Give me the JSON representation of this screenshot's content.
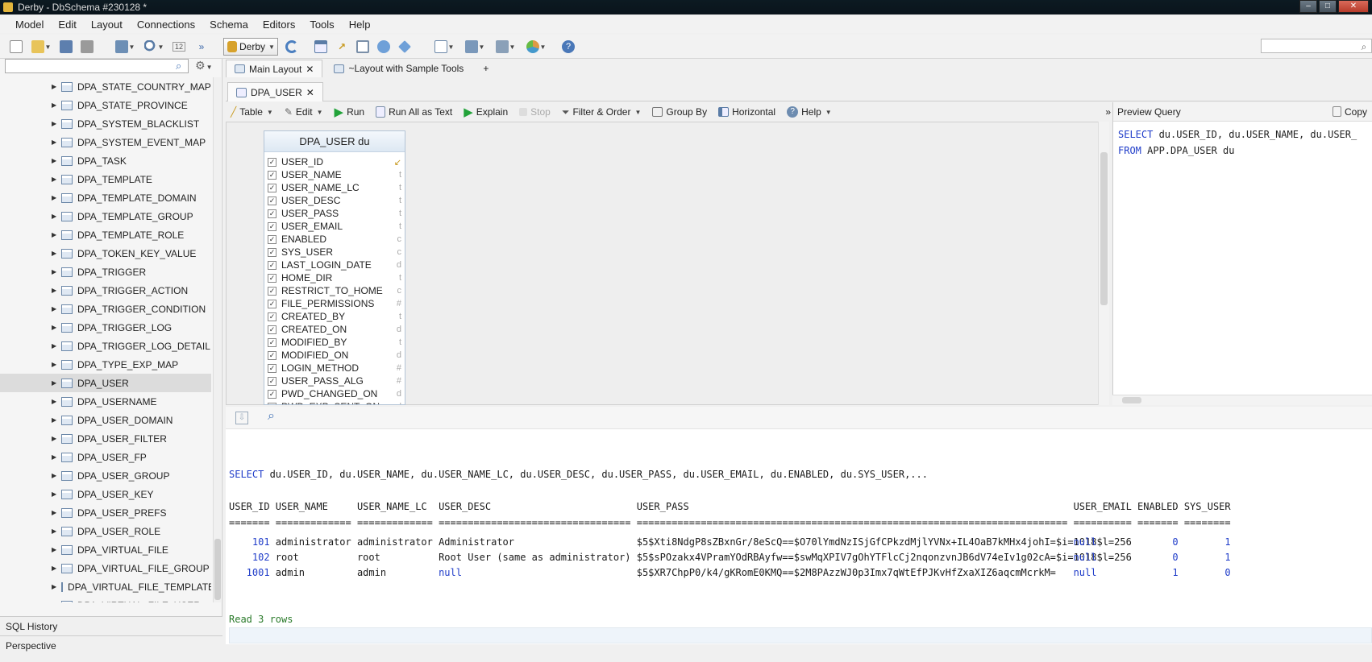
{
  "window": {
    "title": "Derby - DbSchema #230128 *"
  },
  "menu": [
    "Model",
    "Edit",
    "Layout",
    "Connections",
    "Schema",
    "Editors",
    "Tools",
    "Help"
  ],
  "toolbar": {
    "db_selector": "Derby",
    "page_label": "12"
  },
  "tree": {
    "items": [
      "DPA_STATE_COUNTRY_MAP",
      "DPA_STATE_PROVINCE",
      "DPA_SYSTEM_BLACKLIST",
      "DPA_SYSTEM_EVENT_MAP",
      "DPA_TASK",
      "DPA_TEMPLATE",
      "DPA_TEMPLATE_DOMAIN",
      "DPA_TEMPLATE_GROUP",
      "DPA_TEMPLATE_ROLE",
      "DPA_TOKEN_KEY_VALUE",
      "DPA_TRIGGER",
      "DPA_TRIGGER_ACTION",
      "DPA_TRIGGER_CONDITION",
      "DPA_TRIGGER_LOG",
      "DPA_TRIGGER_LOG_DETAIL",
      "DPA_TYPE_EXP_MAP",
      "DPA_USER",
      "DPA_USERNAME",
      "DPA_USER_DOMAIN",
      "DPA_USER_FILTER",
      "DPA_USER_FP",
      "DPA_USER_GROUP",
      "DPA_USER_KEY",
      "DPA_USER_PREFS",
      "DPA_USER_ROLE",
      "DPA_VIRTUAL_FILE",
      "DPA_VIRTUAL_FILE_GROUP",
      "DPA_VIRTUAL_FILE_TEMPLATE",
      "DPA_VIRTUAL_FILE_USER"
    ],
    "selected": "DPA_USER"
  },
  "bottom_tabs": {
    "sql_history": "SQL History",
    "perspective": "Perspective"
  },
  "layout_tabs": {
    "main": "Main Layout",
    "sample": "~Layout with Sample Tools",
    "add": "+"
  },
  "editor_tab": "DPA_USER",
  "query_toolbar": {
    "table": "Table",
    "edit": "Edit",
    "run": "Run",
    "run_all": "Run All as Text",
    "explain": "Explain",
    "stop": "Stop",
    "filter": "Filter & Order",
    "group": "Group By",
    "horizontal": "Horizontal",
    "help": "Help",
    "more": "»"
  },
  "table_box": {
    "title": "DPA_USER du",
    "columns": [
      {
        "name": "USER_ID",
        "type": "↙"
      },
      {
        "name": "USER_NAME",
        "type": "t"
      },
      {
        "name": "USER_NAME_LC",
        "type": "t"
      },
      {
        "name": "USER_DESC",
        "type": "t"
      },
      {
        "name": "USER_PASS",
        "type": "t"
      },
      {
        "name": "USER_EMAIL",
        "type": "t"
      },
      {
        "name": "ENABLED",
        "type": "c"
      },
      {
        "name": "SYS_USER",
        "type": "c"
      },
      {
        "name": "LAST_LOGIN_DATE",
        "type": "d"
      },
      {
        "name": "HOME_DIR",
        "type": "t"
      },
      {
        "name": "RESTRICT_TO_HOME",
        "type": "c"
      },
      {
        "name": "FILE_PERMISSIONS",
        "type": "#"
      },
      {
        "name": "CREATED_BY",
        "type": "t"
      },
      {
        "name": "CREATED_ON",
        "type": "d"
      },
      {
        "name": "MODIFIED_BY",
        "type": "t"
      },
      {
        "name": "MODIFIED_ON",
        "type": "d"
      },
      {
        "name": "LOGIN_METHOD",
        "type": "#"
      },
      {
        "name": "USER_PASS_ALG",
        "type": "#"
      },
      {
        "name": "PWD_CHANGED_ON",
        "type": "d"
      },
      {
        "name": "PWD_EXP_SENT_ON",
        "type": "d"
      }
    ]
  },
  "preview": {
    "title": "Preview Query",
    "copy": "Copy",
    "line1_kw": "SELECT",
    "line1_rest": " du.USER_ID, du.USER_NAME, du.USER_",
    "line2_kw": "FROM",
    "line2_rest": " APP.DPA_USER du"
  },
  "results": {
    "query_kw": "SELECT",
    "query_rest": " du.USER_ID, du.USER_NAME, du.USER_NAME_LC, du.USER_DESC, du.USER_PASS, du.USER_EMAIL, du.ENABLED, du.SYS_USER,...",
    "header": "USER_ID USER_NAME     USER_NAME_LC  USER_DESC                         USER_PASS                                                                  USER_EMAIL ENABLED SYS_USER",
    "separator": "======= ============= ============= ================================= ========================================================================== ========== ======= ========",
    "rows": [
      {
        "id": "101",
        "name": "administrator",
        "name_lc": "administrator",
        "desc": "Administrator",
        "pass": "$5$Xti8NdgP8sZBxnGr/8eScQ==$O70lYmdNzISjGfCPkzdMjlYVNx+IL4OaB7kMHx4johI=$i=1018$l=256",
        "email": "null",
        "enabled": "0",
        "sys": "1"
      },
      {
        "id": "102",
        "name": "root",
        "name_lc": "root",
        "desc": "Root User (same as administrator)",
        "pass": "$5$sPOzakx4VPramYOdRBAyfw==$swMqXPIV7gOhYTFlcCj2nqonzvnJB6dV74eIv1g02cA=$i=1018$l=256",
        "email": "null",
        "enabled": "0",
        "sys": "1"
      },
      {
        "id": "1001",
        "name": "admin",
        "name_lc": "admin",
        "desc": "null",
        "pass": "$5$XR7ChpP0/k4/gKRomE0KMQ==$2M8PAzzWJ0p3Imx7qWtEfPJKvHfZxaXIZ6aqcmMcrkM=",
        "email": "null",
        "enabled": "1",
        "sys": "0"
      }
    ],
    "footer": "Read 3 rows"
  }
}
